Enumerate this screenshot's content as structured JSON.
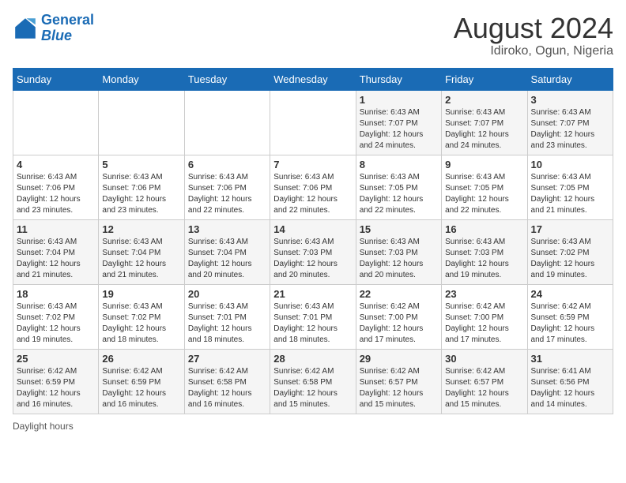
{
  "header": {
    "logo_line1": "General",
    "logo_line2": "Blue",
    "month_year": "August 2024",
    "location": "Idiroko, Ogun, Nigeria"
  },
  "weekdays": [
    "Sunday",
    "Monday",
    "Tuesday",
    "Wednesday",
    "Thursday",
    "Friday",
    "Saturday"
  ],
  "weeks": [
    [
      {
        "day": "",
        "info": ""
      },
      {
        "day": "",
        "info": ""
      },
      {
        "day": "",
        "info": ""
      },
      {
        "day": "",
        "info": ""
      },
      {
        "day": "1",
        "info": "Sunrise: 6:43 AM\nSunset: 7:07 PM\nDaylight: 12 hours and 24 minutes."
      },
      {
        "day": "2",
        "info": "Sunrise: 6:43 AM\nSunset: 7:07 PM\nDaylight: 12 hours and 24 minutes."
      },
      {
        "day": "3",
        "info": "Sunrise: 6:43 AM\nSunset: 7:07 PM\nDaylight: 12 hours and 23 minutes."
      }
    ],
    [
      {
        "day": "4",
        "info": "Sunrise: 6:43 AM\nSunset: 7:06 PM\nDaylight: 12 hours and 23 minutes."
      },
      {
        "day": "5",
        "info": "Sunrise: 6:43 AM\nSunset: 7:06 PM\nDaylight: 12 hours and 23 minutes."
      },
      {
        "day": "6",
        "info": "Sunrise: 6:43 AM\nSunset: 7:06 PM\nDaylight: 12 hours and 22 minutes."
      },
      {
        "day": "7",
        "info": "Sunrise: 6:43 AM\nSunset: 7:06 PM\nDaylight: 12 hours and 22 minutes."
      },
      {
        "day": "8",
        "info": "Sunrise: 6:43 AM\nSunset: 7:05 PM\nDaylight: 12 hours and 22 minutes."
      },
      {
        "day": "9",
        "info": "Sunrise: 6:43 AM\nSunset: 7:05 PM\nDaylight: 12 hours and 22 minutes."
      },
      {
        "day": "10",
        "info": "Sunrise: 6:43 AM\nSunset: 7:05 PM\nDaylight: 12 hours and 21 minutes."
      }
    ],
    [
      {
        "day": "11",
        "info": "Sunrise: 6:43 AM\nSunset: 7:04 PM\nDaylight: 12 hours and 21 minutes."
      },
      {
        "day": "12",
        "info": "Sunrise: 6:43 AM\nSunset: 7:04 PM\nDaylight: 12 hours and 21 minutes."
      },
      {
        "day": "13",
        "info": "Sunrise: 6:43 AM\nSunset: 7:04 PM\nDaylight: 12 hours and 20 minutes."
      },
      {
        "day": "14",
        "info": "Sunrise: 6:43 AM\nSunset: 7:03 PM\nDaylight: 12 hours and 20 minutes."
      },
      {
        "day": "15",
        "info": "Sunrise: 6:43 AM\nSunset: 7:03 PM\nDaylight: 12 hours and 20 minutes."
      },
      {
        "day": "16",
        "info": "Sunrise: 6:43 AM\nSunset: 7:03 PM\nDaylight: 12 hours and 19 minutes."
      },
      {
        "day": "17",
        "info": "Sunrise: 6:43 AM\nSunset: 7:02 PM\nDaylight: 12 hours and 19 minutes."
      }
    ],
    [
      {
        "day": "18",
        "info": "Sunrise: 6:43 AM\nSunset: 7:02 PM\nDaylight: 12 hours and 19 minutes."
      },
      {
        "day": "19",
        "info": "Sunrise: 6:43 AM\nSunset: 7:02 PM\nDaylight: 12 hours and 18 minutes."
      },
      {
        "day": "20",
        "info": "Sunrise: 6:43 AM\nSunset: 7:01 PM\nDaylight: 12 hours and 18 minutes."
      },
      {
        "day": "21",
        "info": "Sunrise: 6:43 AM\nSunset: 7:01 PM\nDaylight: 12 hours and 18 minutes."
      },
      {
        "day": "22",
        "info": "Sunrise: 6:42 AM\nSunset: 7:00 PM\nDaylight: 12 hours and 17 minutes."
      },
      {
        "day": "23",
        "info": "Sunrise: 6:42 AM\nSunset: 7:00 PM\nDaylight: 12 hours and 17 minutes."
      },
      {
        "day": "24",
        "info": "Sunrise: 6:42 AM\nSunset: 6:59 PM\nDaylight: 12 hours and 17 minutes."
      }
    ],
    [
      {
        "day": "25",
        "info": "Sunrise: 6:42 AM\nSunset: 6:59 PM\nDaylight: 12 hours and 16 minutes."
      },
      {
        "day": "26",
        "info": "Sunrise: 6:42 AM\nSunset: 6:59 PM\nDaylight: 12 hours and 16 minutes."
      },
      {
        "day": "27",
        "info": "Sunrise: 6:42 AM\nSunset: 6:58 PM\nDaylight: 12 hours and 16 minutes."
      },
      {
        "day": "28",
        "info": "Sunrise: 6:42 AM\nSunset: 6:58 PM\nDaylight: 12 hours and 15 minutes."
      },
      {
        "day": "29",
        "info": "Sunrise: 6:42 AM\nSunset: 6:57 PM\nDaylight: 12 hours and 15 minutes."
      },
      {
        "day": "30",
        "info": "Sunrise: 6:42 AM\nSunset: 6:57 PM\nDaylight: 12 hours and 15 minutes."
      },
      {
        "day": "31",
        "info": "Sunrise: 6:41 AM\nSunset: 6:56 PM\nDaylight: 12 hours and 14 minutes."
      }
    ]
  ],
  "footer": {
    "daylight_label": "Daylight hours"
  }
}
